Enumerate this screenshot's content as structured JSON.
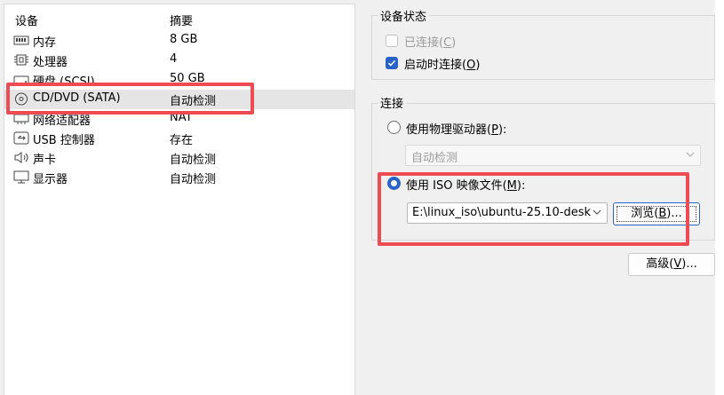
{
  "device_list": {
    "header": {
      "name": "设备",
      "summary": "摘要"
    },
    "rows": [
      {
        "name": "内存",
        "summary": "8 GB",
        "icon": "memory-icon"
      },
      {
        "name": "处理器",
        "summary": "4",
        "icon": "processor-icon"
      },
      {
        "name": "硬盘 (SCSI)",
        "summary": "50 GB",
        "icon": "hard-disk-icon"
      },
      {
        "name": "CD/DVD (SATA)",
        "summary": "自动检测",
        "icon": "cd-dvd-icon",
        "selected": true
      },
      {
        "name": "网络适配器",
        "summary": "NAT",
        "icon": "network-adapter-icon"
      },
      {
        "name": "USB 控制器",
        "summary": "存在",
        "icon": "usb-controller-icon"
      },
      {
        "name": "声卡",
        "summary": "自动检测",
        "icon": "sound-card-icon"
      },
      {
        "name": "显示器",
        "summary": "自动检测",
        "icon": "display-icon"
      }
    ]
  },
  "device_status": {
    "title": "设备状态",
    "connected": {
      "label": "已连接",
      "hotkey": "C",
      "checked": false,
      "enabled": false
    },
    "connect_at_power_on": {
      "label": "启动时连接",
      "hotkey": "O",
      "checked": true,
      "enabled": true
    }
  },
  "connection": {
    "title": "连接",
    "physical_drive": {
      "label": "使用物理驱动器",
      "hotkey": "P",
      "selected": false
    },
    "physical_drive_select": {
      "value": "自动检测"
    },
    "iso_image": {
      "label": "使用 ISO 映像文件",
      "hotkey": "M",
      "selected": true
    },
    "iso_path": {
      "value": "E:\\linux_iso\\ubuntu-25.10-desk"
    },
    "browse_button": {
      "label": "浏览",
      "hotkey": "B",
      "suffix": ")..."
    }
  },
  "advanced_button": {
    "label": "高级",
    "hotkey": "V",
    "suffix": ")..."
  },
  "colors": {
    "accent": "#2a63c8",
    "highlight": "#ee4c52"
  }
}
